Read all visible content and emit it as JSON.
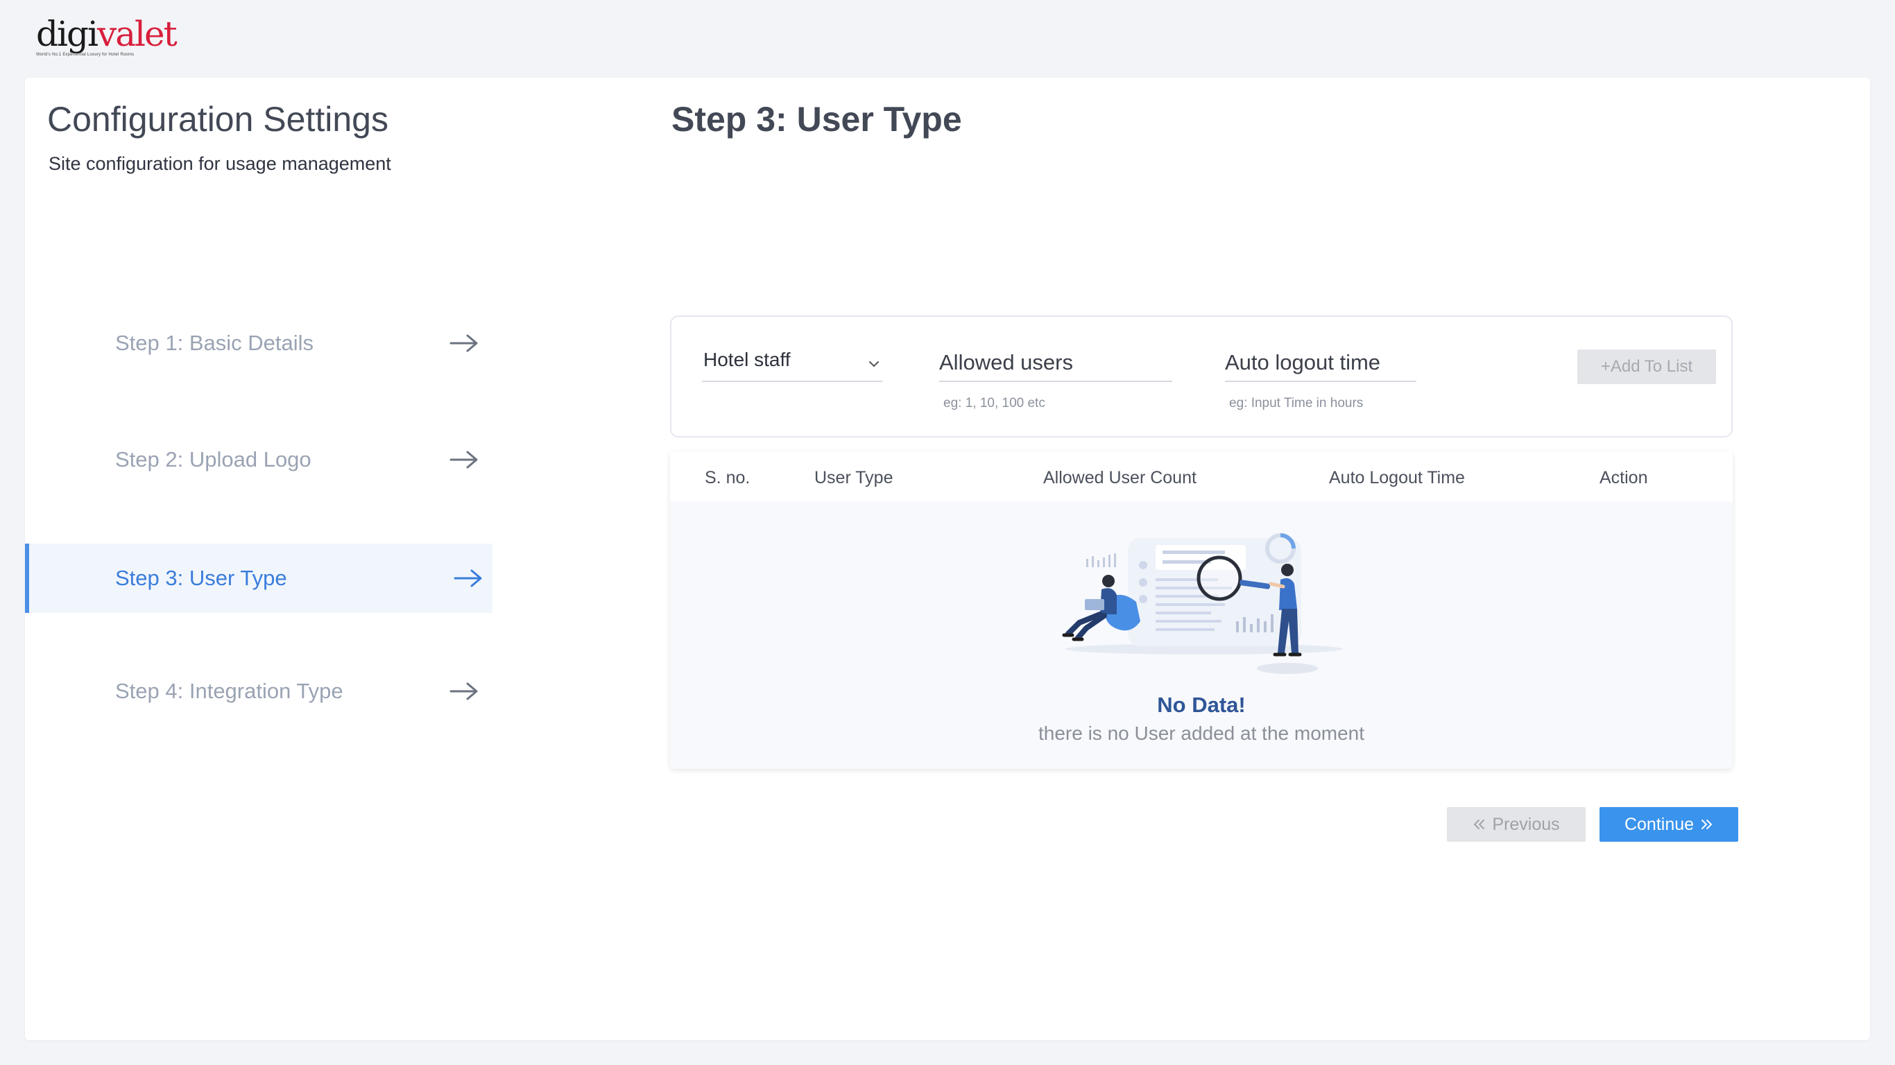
{
  "brand": {
    "logo_main": "digi",
    "logo_accent": "valet",
    "logo_tagline": "World's No.1 Experiential Luxury for Hotel Rooms"
  },
  "header": {
    "title": "Configuration Settings",
    "subtitle": "Site configuration for usage management"
  },
  "steps": [
    {
      "label": "Step 1: Basic Details",
      "active": false
    },
    {
      "label": "Step 2: Upload Logo",
      "active": false
    },
    {
      "label": "Step 3: User Type",
      "active": true
    },
    {
      "label": "Step 4: Integration Type",
      "active": false
    }
  ],
  "main": {
    "heading": "Step 3: User Type"
  },
  "form": {
    "user_type_select": "Hotel staff",
    "allowed_users_placeholder": "Allowed users",
    "allowed_users_hint": "eg: 1, 10, 100 etc",
    "auto_logout_placeholder": "Auto logout time",
    "auto_logout_hint": "eg: Input Time in hours",
    "add_button": "+Add To List"
  },
  "table": {
    "columns": [
      "S. no.",
      "User Type",
      "Allowed User Count",
      "Auto Logout Time",
      "Action"
    ],
    "rows": [],
    "empty_title": "No Data!",
    "empty_text": "there is no User added at the moment"
  },
  "navigation": {
    "previous_label": "Previous",
    "continue_label": "Continue"
  },
  "colors": {
    "accent": "#3a93ec",
    "active_step": "#3a7ddb",
    "brand_red": "#d81f3c",
    "empty_title": "#2f5597"
  },
  "icons": {
    "step_arrow": "arrow-right-icon",
    "select": "chevron-down-icon",
    "previous": "double-chevron-left-icon",
    "continue": "double-chevron-right-icon"
  }
}
